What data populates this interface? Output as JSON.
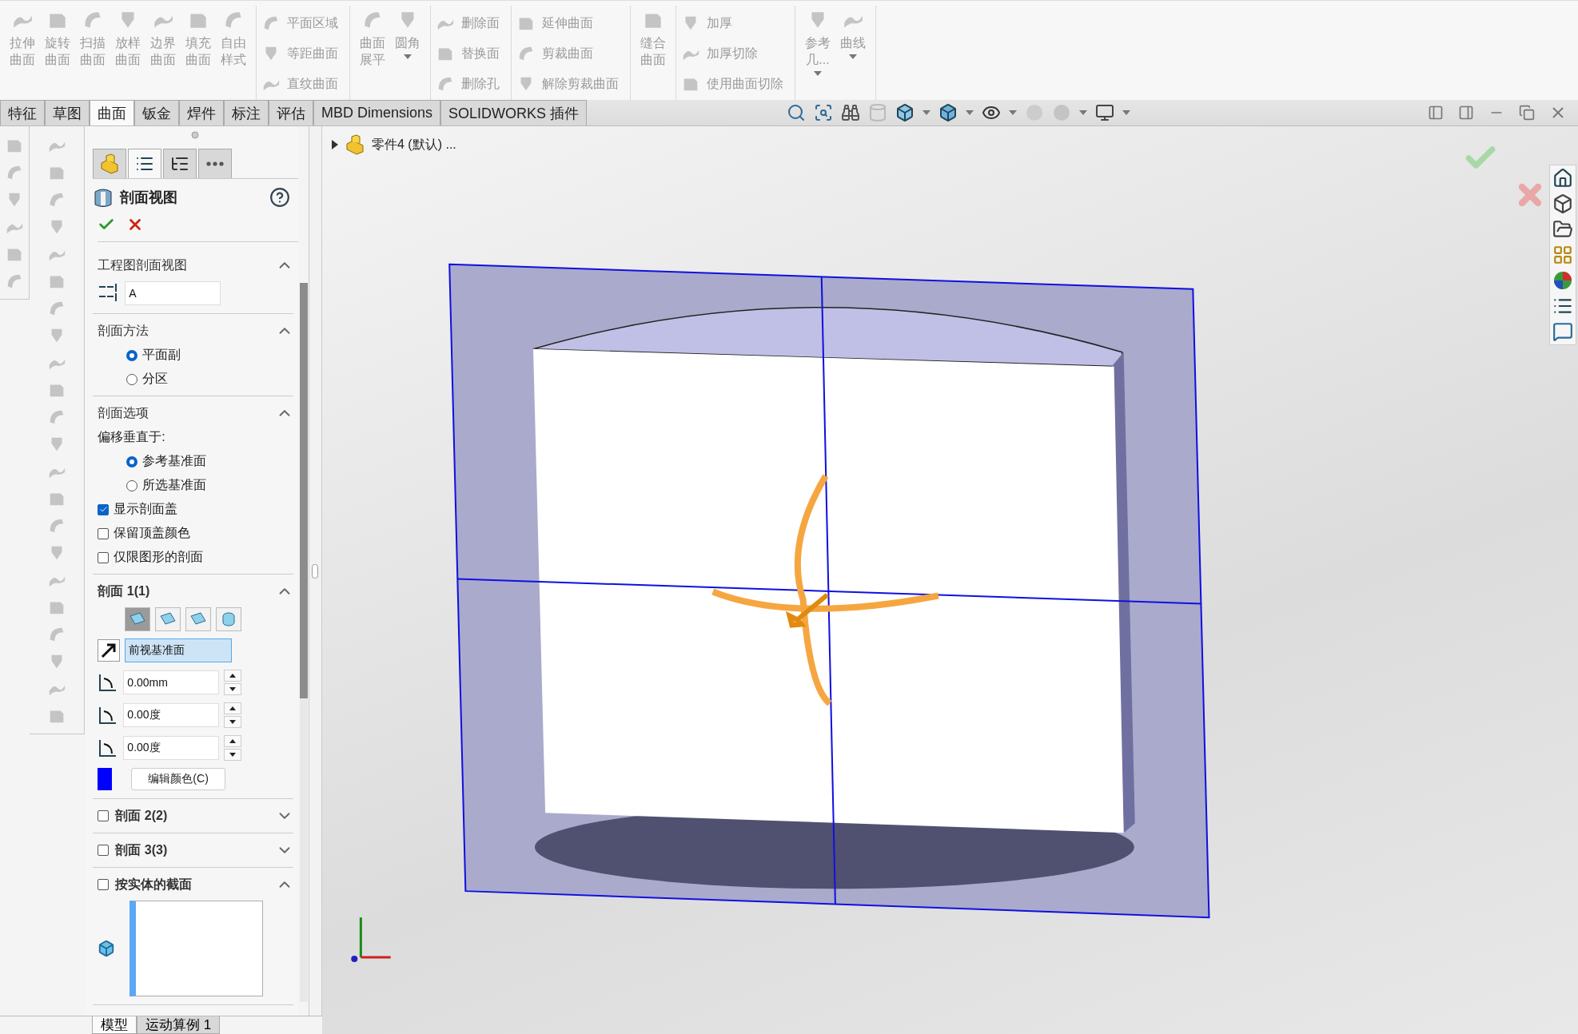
{
  "ribbon": {
    "groups": [
      {
        "kind": "large",
        "items": [
          {
            "lines": [
              "拉伸",
              "曲面"
            ],
            "disabled": true
          },
          {
            "lines": [
              "旋转",
              "曲面"
            ],
            "disabled": true
          },
          {
            "lines": [
              "扫描",
              "曲面"
            ],
            "disabled": true
          },
          {
            "lines": [
              "放样",
              "曲面"
            ],
            "disabled": true
          },
          {
            "lines": [
              "边界",
              "曲面"
            ],
            "disabled": true
          },
          {
            "lines": [
              "填充",
              "曲面"
            ],
            "disabled": true
          },
          {
            "lines": [
              "自由",
              "样式"
            ],
            "disabled": true
          }
        ]
      },
      {
        "kind": "stack",
        "items": [
          {
            "label": "平面区域",
            "disabled": true
          },
          {
            "label": "等距曲面",
            "disabled": true
          },
          {
            "label": "直纹曲面",
            "disabled": true
          }
        ]
      },
      {
        "kind": "large",
        "items": [
          {
            "lines": [
              "曲面",
              "展平"
            ],
            "disabled": true
          },
          {
            "lines": [
              "圆角"
            ],
            "disabled": true,
            "menu": true
          }
        ]
      },
      {
        "kind": "stack",
        "items": [
          {
            "label": "删除面",
            "disabled": true
          },
          {
            "label": "替换面",
            "disabled": true
          },
          {
            "label": "删除孔",
            "disabled": true
          }
        ]
      },
      {
        "kind": "stack",
        "items": [
          {
            "label": "延伸曲面",
            "disabled": true
          },
          {
            "label": "剪裁曲面",
            "disabled": true
          },
          {
            "label": "解除剪裁曲面",
            "disabled": true
          }
        ]
      },
      {
        "kind": "large",
        "items": [
          {
            "lines": [
              "缝合",
              "曲面"
            ],
            "disabled": true
          }
        ]
      },
      {
        "kind": "stack",
        "items": [
          {
            "label": "加厚",
            "disabled": true
          },
          {
            "label": "加厚切除",
            "disabled": true
          },
          {
            "label": "使用曲面切除",
            "disabled": true
          }
        ]
      },
      {
        "kind": "large",
        "items": [
          {
            "lines": [
              "参考",
              "几..."
            ],
            "disabled": true,
            "menu": true
          },
          {
            "lines": [
              "曲线"
            ],
            "disabled": true,
            "menu": true
          }
        ]
      }
    ]
  },
  "tabs": [
    {
      "label": "特征",
      "selected": false
    },
    {
      "label": "草图",
      "selected": false
    },
    {
      "label": "曲面",
      "selected": true
    },
    {
      "label": "钣金",
      "selected": false
    },
    {
      "label": "焊件",
      "selected": false
    },
    {
      "label": "标注",
      "selected": false
    },
    {
      "label": "评估",
      "selected": false
    },
    {
      "label": "MBD Dimensions",
      "selected": false
    },
    {
      "label": "SOLIDWORKS 插件",
      "selected": false
    }
  ],
  "document": {
    "title": "零件4 (默认) ..."
  },
  "property_manager": {
    "tabs": [
      {
        "selected": false
      },
      {
        "selected": true
      },
      {
        "selected": false
      },
      {
        "selected": false
      }
    ],
    "title": "剖面视图",
    "sections": [
      {
        "kind": "text",
        "title": "工程图剖面视图",
        "expanded": true,
        "value": "A"
      },
      {
        "kind": "radio",
        "title": "剖面方法",
        "expanded": true,
        "options": [
          {
            "label": "平面副",
            "selected": true
          },
          {
            "label": "分区",
            "selected": false
          }
        ]
      },
      {
        "kind": "options",
        "title": "剖面选项",
        "expanded": true,
        "caption": "偏移垂直于:",
        "options": [
          {
            "label": "参考基准面",
            "selected": true
          },
          {
            "label": "所选基准面",
            "selected": false
          }
        ],
        "checks": [
          {
            "label": "显示剖面盖",
            "checked": true
          },
          {
            "label": "保留顶盖颜色",
            "checked": false
          },
          {
            "label": "仅限图形的剖面",
            "checked": false
          }
        ]
      },
      {
        "kind": "plane",
        "title": "剖面 1(1)",
        "expanded": true,
        "modes": [
          {
            "selected": true
          },
          {
            "selected": false
          },
          {
            "selected": false
          },
          {
            "selected": false
          }
        ],
        "reference": "前视基准面",
        "distance": "0.00mm",
        "angle_x": "0.00度",
        "angle_y": "0.00度",
        "color": "#0000ff",
        "button": "编辑颜色(C)"
      },
      {
        "kind": "toggle",
        "title": "剖面 2(2)",
        "checked": false,
        "expanded": false
      },
      {
        "kind": "toggle",
        "title": "剖面 3(3)",
        "checked": false,
        "expanded": false
      },
      {
        "kind": "bodies",
        "title": "按实体的截面",
        "checked": false,
        "expanded": true
      }
    ]
  },
  "bottom_tabs": [
    {
      "label": "模型",
      "selected": true
    },
    {
      "label": "运动算例 1",
      "selected": false
    }
  ]
}
